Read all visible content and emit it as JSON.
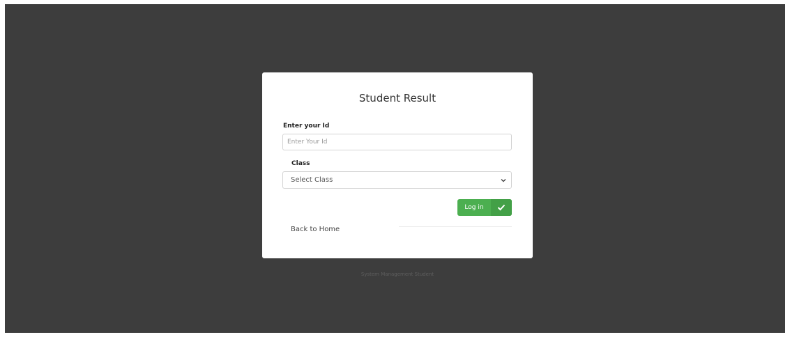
{
  "login_card": {
    "title": "Student Result",
    "id_label": "Enter your Id",
    "id_placeholder": "Enter Your Id",
    "id_value": "",
    "class_label": "Class",
    "class_selected": "Select Class",
    "login_label": "Log in",
    "login_icon": "checkmark-icon",
    "back_link": "Back to Home"
  },
  "footer": {
    "text": "System Management Student"
  },
  "colors": {
    "background": "#3d3d3d",
    "card": "#ffffff",
    "accent": "#4caf50"
  }
}
